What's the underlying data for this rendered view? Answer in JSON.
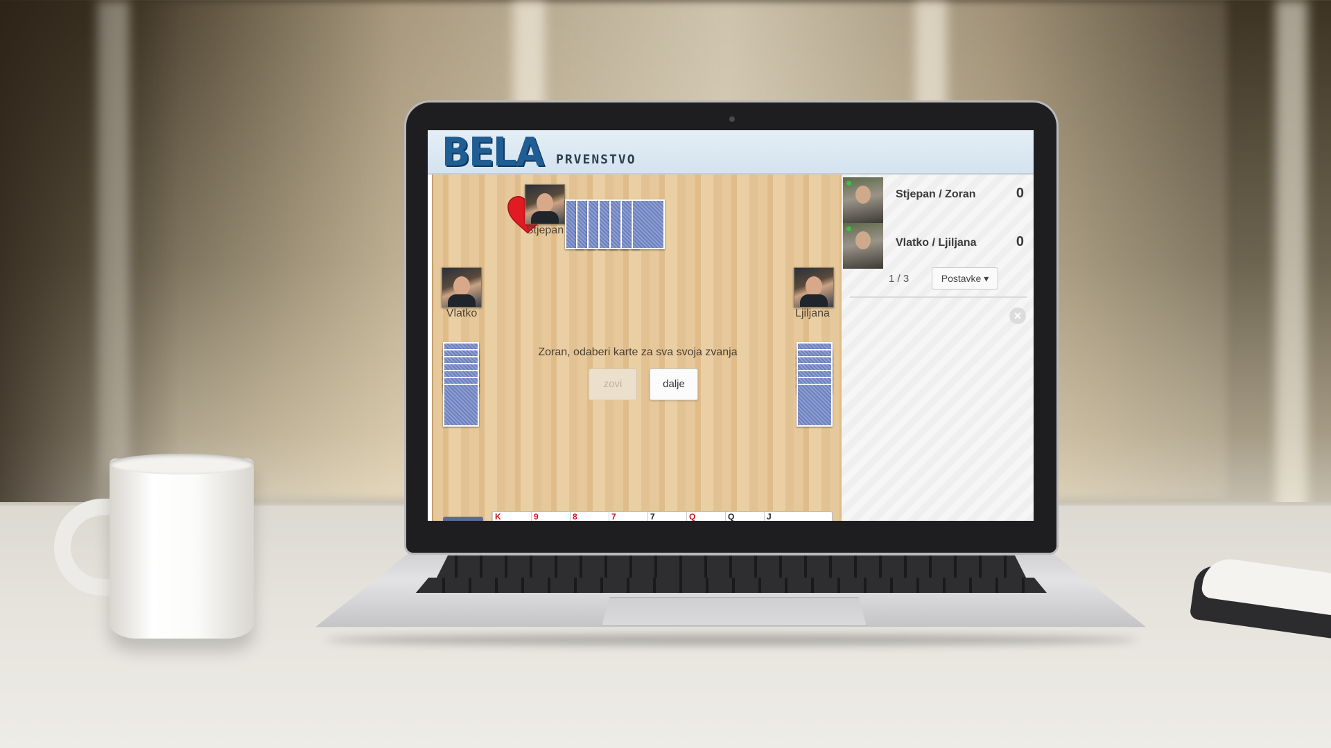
{
  "app": {
    "logo": "BELA",
    "logo_subtitle": "PRVENSTVO"
  },
  "game": {
    "trump_suit_icon": "heart-icon",
    "players": {
      "top": "Stjepan",
      "left": "Vlatko",
      "right": "Ljiljana"
    },
    "prompt": "Zoran, odaberi karte za sva svoja zvanja",
    "buttons": {
      "call": "zovi",
      "next": "dalje"
    },
    "hand_cards": [
      "K",
      "9",
      "8",
      "7",
      "7",
      "Q",
      "Q",
      "J"
    ]
  },
  "sidebar": {
    "teams": [
      {
        "name": "Stjepan / Zoran",
        "score": "0"
      },
      {
        "name": "Vlatko / Ljiljana",
        "score": "0"
      }
    ],
    "round": "1 / 3",
    "settings_label": "Postavke ▾"
  },
  "colors": {
    "logo_blue": "#1f5d93",
    "heart_red": "#e21b22",
    "card_back": "#7c8fc6",
    "online_green": "#39c43f"
  }
}
